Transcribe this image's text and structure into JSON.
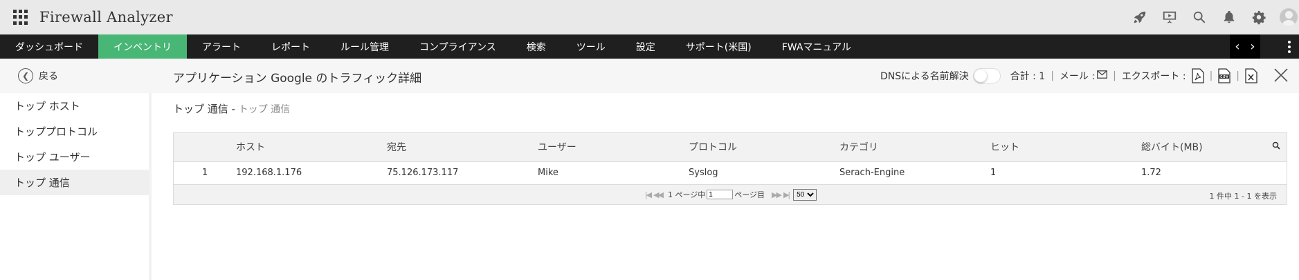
{
  "header": {
    "title": "Firewall Analyzer"
  },
  "nav": {
    "items": [
      {
        "label": "ダッシュボード"
      },
      {
        "label": "インベントリ"
      },
      {
        "label": "アラート"
      },
      {
        "label": "レポート"
      },
      {
        "label": "ルール管理"
      },
      {
        "label": "コンプライアンス"
      },
      {
        "label": "検索"
      },
      {
        "label": "ツール"
      },
      {
        "label": "設定"
      },
      {
        "label": "サポート(米国)"
      },
      {
        "label": "FWAマニュアル"
      }
    ],
    "active_index": 1,
    "prev": "‹",
    "next": "›"
  },
  "subbar": {
    "back_label": "戻る",
    "page_title": "アプリケーション Google のトラフィック詳細",
    "dns_label": "DNSによる名前解決",
    "total_label": "合計 : 1",
    "mail_label": "メール :",
    "export_label": "エクスポート :"
  },
  "sidebar": {
    "items": [
      {
        "label": "トップ ホスト"
      },
      {
        "label": "トッププロトコル"
      },
      {
        "label": "トップ ユーザー"
      },
      {
        "label": "トップ 通信"
      }
    ],
    "active_index": 3
  },
  "content": {
    "subtitle_main": "トップ 通信 - ",
    "subtitle_muted": "トップ 通信"
  },
  "table": {
    "columns": [
      "",
      "ホスト",
      "宛先",
      "ユーザー",
      "プロトコル",
      "カテゴリ",
      "ヒット",
      "総バイト(MB)"
    ],
    "rows": [
      [
        "1",
        "192.168.1.176",
        "75.126.173.117",
        "Mike",
        "Syslog",
        "Serach-Engine",
        "1",
        "1.72"
      ]
    ]
  },
  "pager": {
    "page_prefix": "1 ページ中",
    "page_value": "1",
    "page_suffix": "ページ目",
    "per_page_selected": "50",
    "count_text": "1 件中 1 - 1 を表示"
  },
  "colors": {
    "nav_bg": "#1f1f1f",
    "nav_active": "#48b675",
    "header_bg": "#e9e9e9"
  }
}
